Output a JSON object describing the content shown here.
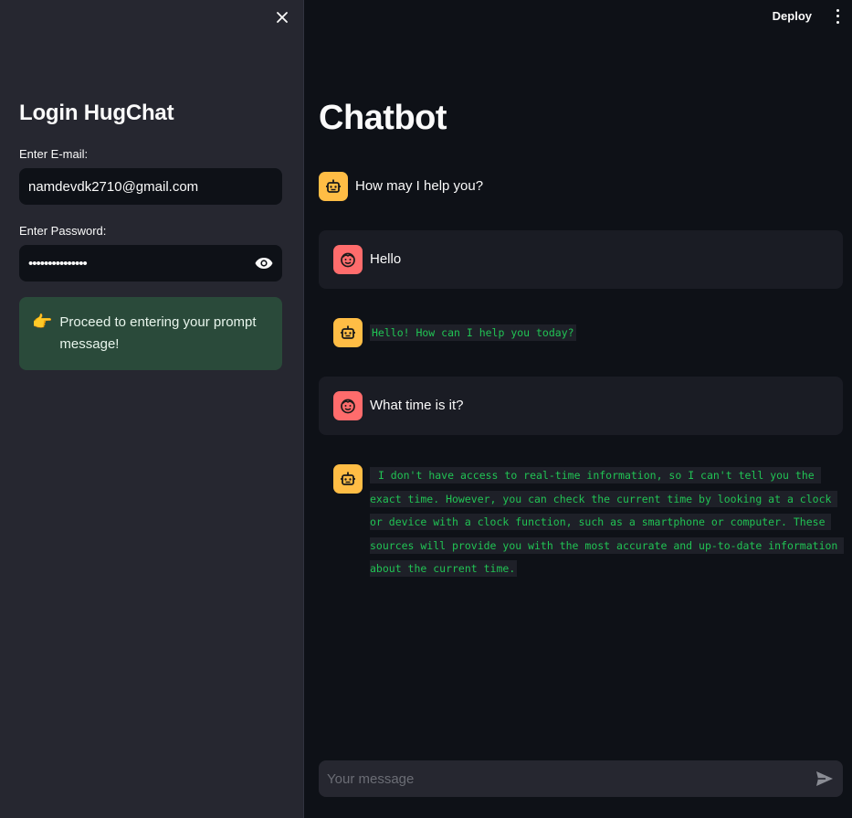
{
  "sidebar": {
    "title": "Login HugChat",
    "email_label": "Enter E-mail:",
    "email_value": "namdevdk2710@gmail.com",
    "password_label": "Enter Password:",
    "password_value": "•••••••••••••••",
    "alert_icon": "👉",
    "alert_text": "Proceed to entering your prompt message!"
  },
  "header": {
    "deploy_label": "Deploy"
  },
  "main": {
    "title": "Chatbot",
    "messages": [
      {
        "role": "assistant",
        "text": "How may I help you?"
      },
      {
        "role": "user",
        "text": "Hello"
      },
      {
        "role": "assistant",
        "text": "Hello! How can I help you today?"
      },
      {
        "role": "user",
        "text": "What time is it?"
      },
      {
        "role": "assistant",
        "text": " I don't have access to real-time information, so I can't tell you the exact time. However, you can check the current time by looking at a clock or device with a clock function, such as a smartphone or computer. These sources will provide you with the most accurate and up-to-date information about the current time."
      }
    ],
    "chat_input_placeholder": "Your message"
  },
  "colors": {
    "background": "#0e1117",
    "sidebar": "#262730",
    "bot_avatar": "#ffbd45",
    "user_avatar": "#ff6c6c",
    "code_text": "#21c354",
    "alert_bg": "#2a4a3a"
  },
  "icons": {
    "close": "close-icon",
    "eye": "eye-icon",
    "bot": "robot-icon",
    "user": "smiley-face-icon",
    "send": "send-icon",
    "menu": "kebab-menu-icon"
  }
}
